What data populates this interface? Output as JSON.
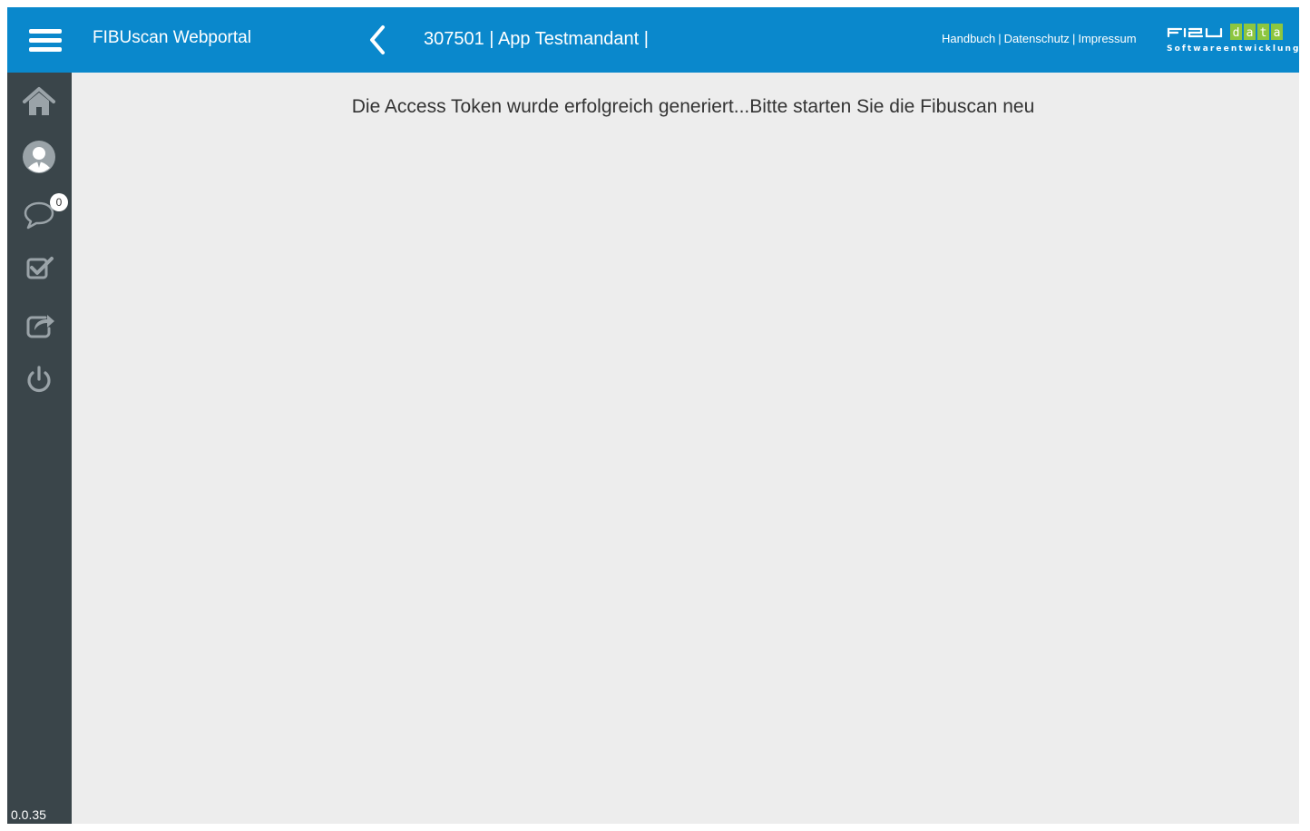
{
  "header": {
    "app_title": "FIBUscan Webportal",
    "client_title": "307501 | App Testmandant |",
    "links": {
      "handbuch": "Handbuch",
      "datenschutz": "Datenschutz",
      "impressum": "Impressum",
      "separator": "|"
    },
    "logo": {
      "brand_left": "FIBU",
      "brand_right": "data",
      "subtitle": "Softwareentwicklung"
    }
  },
  "sidebar": {
    "icons": [
      "home-icon",
      "user-profile-icon",
      "messages-icon",
      "tasks-icon",
      "share-icon",
      "power-icon"
    ],
    "messages_count": "0",
    "version": "0.0.35"
  },
  "main": {
    "message": "Die Access Token wurde erfolgreich generiert...Bitte starten Sie die Fibuscan neu"
  },
  "colors": {
    "header_bg": "#0a88cc",
    "sidebar_bg": "#3a454a",
    "content_bg": "#ededed",
    "logo_green": "#8dc63f"
  }
}
